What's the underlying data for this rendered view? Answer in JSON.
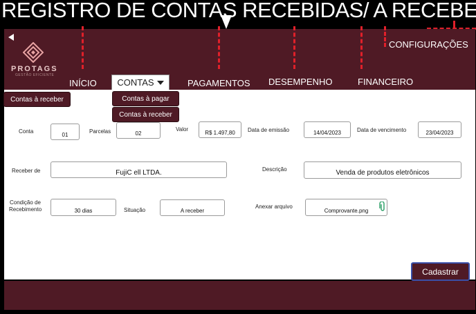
{
  "title": "REGISTRO DE CONTAS RECEBIDAS/ A RECEBER",
  "logo": {
    "name": "PROTAGS",
    "tagline": "GESTÃO EFICIENTE"
  },
  "nav": {
    "settings": "CONFIGURAÇÕES",
    "inicio": "INÍCIO",
    "contas": "CONTAS",
    "pagamentos": "PAGAMENTOS",
    "desempenho": "DESEMPENHO",
    "financeiro": "FINANCEIRO"
  },
  "contas_menu": {
    "pagar": "Contas à pagar",
    "receber": "Contas à receber"
  },
  "side_tab": "Contas à receber",
  "form": {
    "conta": {
      "label": "Conta",
      "value": "01"
    },
    "parcelas": {
      "label": "Parcelas",
      "value": "02"
    },
    "valor": {
      "label": "Valor",
      "value": "R$ 1.497,80"
    },
    "emissao": {
      "label": "Data de emissão",
      "value": "14/04/2023"
    },
    "vencimento": {
      "label": "Data de vencimento",
      "value": "23/04/2023"
    },
    "receber_de": {
      "label": "Receber de",
      "value": "FujiC ell LTDA."
    },
    "descricao": {
      "label": "Descrição",
      "value": "Venda de produtos eletrônicos"
    },
    "condicao": {
      "label_line1": "Condição de",
      "label_line2": "Recebimento",
      "value": "30 dias"
    },
    "situacao": {
      "label": "Situação",
      "value": "A receber"
    },
    "anexar": {
      "label": "Anexar arquivo",
      "value": "Comprovante.png"
    }
  },
  "submit": "Cadastrar",
  "colors": {
    "brand": "#4f1a25",
    "accent_dash": "#e0202a"
  },
  "icons": {
    "back": "back-arrow-icon",
    "dropdown": "caret-down-icon",
    "attach": "paperclip-icon",
    "logo": "diamond-logo-icon"
  }
}
